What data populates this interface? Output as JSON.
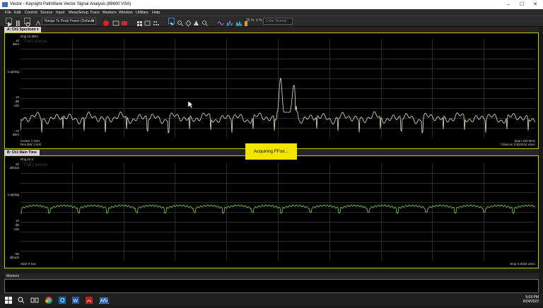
{
  "window": {
    "title": "Vector - Keysight PathWave Vector Signal Analysis (89600 VSA)"
  },
  "menu": [
    "File",
    "Edit",
    "Control",
    "Source",
    "Input",
    "MeasSetup",
    "Trace",
    "Markers",
    "Window",
    "Utilities",
    "Help"
  ],
  "toolbar": {
    "range_dropdown": "Range To Peak Power (Default)",
    "percent": "30 %",
    "zero_percent": "0 %",
    "color_mode": "Color Normal"
  },
  "pane_a": {
    "tab": "A: Ch1 Spectrum",
    "rng": "Rng 10 dBm",
    "watermark": "Trial License",
    "y_top": "10",
    "y_top_unit": "dBm",
    "y_mid": "LogMag",
    "y_div": "10",
    "y_div_unit1": "dB",
    "y_div_unit2": "/div",
    "y_bottom": "-70",
    "y_bottom_unit": "dBm",
    "center": "Center 1 GHz",
    "res_bw": "Res BW 1 kHz",
    "span": "Span 100 MHz",
    "timelen": "TimeLen 3.823242 uSec"
  },
  "pane_b": {
    "tab": "B: Ch1 Main Time",
    "rng": "Rng 10 V",
    "watermark": "Trial License",
    "y_top": "25",
    "y_top_unit": "dBVpk",
    "y_mid": "LogMag",
    "y_div": "10",
    "y_div_unit1": "dB",
    "y_div_unit2": "/div",
    "y_bottom": "-85",
    "y_bottom_unit": "dBVpk",
    "start": "Start 0 Sec",
    "stop": "Stop 3.8184 uSec"
  },
  "acquiring": "Acquiring FFox...",
  "markers": {
    "title": "Markers"
  },
  "taskbar": {
    "time": "5:03 PM",
    "date": "6/24/2022"
  },
  "colors": {
    "trace_a": "#e8e2c0",
    "trace_b": "#7fcf5a",
    "pane_border": "#c8c800",
    "acquiring_bg": "#f2e600"
  }
}
